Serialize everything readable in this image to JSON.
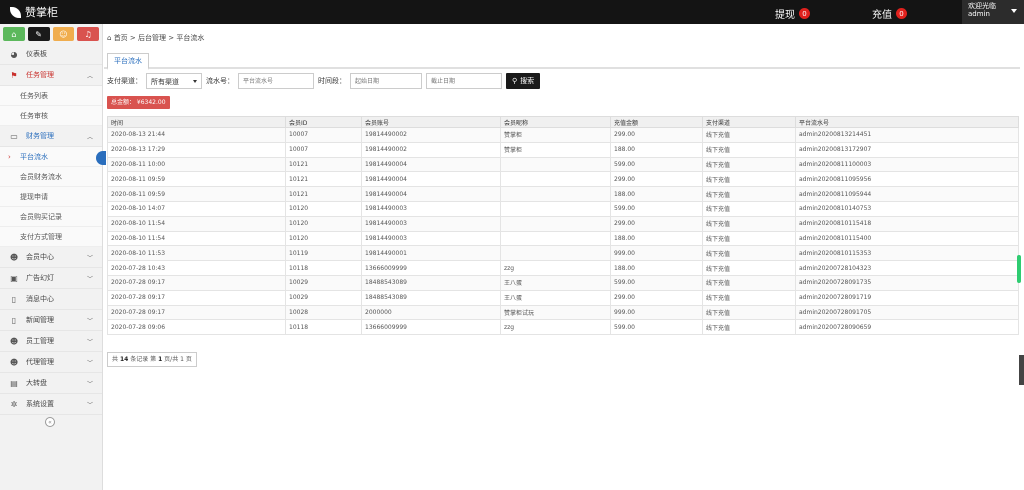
{
  "app": {
    "title": "赞掌柜"
  },
  "topbar": {
    "withdraw_label": "提现",
    "withdraw_count": "0",
    "recharge_label": "充值",
    "recharge_count": "0",
    "welcome": "欢迎光临",
    "username": "admin"
  },
  "colors": {
    "accent": "#c9302c",
    "link": "#2a6ebd",
    "topbar": "#141414",
    "badge": "#e0211d"
  },
  "shortcuts": [
    {
      "icon": "home-icon",
      "color": "#5cb85c"
    },
    {
      "icon": "pencil-icon",
      "color": "#1a1a1a"
    },
    {
      "icon": "users-icon",
      "color": "#f0ad4e"
    },
    {
      "icon": "bell-icon",
      "color": "#d9534f"
    }
  ],
  "sidebar": {
    "dashboard": "仪表板",
    "task_mgmt": "任务管理",
    "task_list": "任务列表",
    "task_review": "任务审核",
    "finance_mgmt": "财务管理",
    "platform_flow": "平台流水",
    "member_finance_flow": "会员财务流水",
    "withdraw_apply": "提现申请",
    "member_purchase": "会员购买记录",
    "payment_mgmt": "支付方式管理",
    "member_center": "会员中心",
    "ads": "广告幻灯",
    "messages": "消息中心",
    "news": "新闻管理",
    "staff": "员工管理",
    "agent": "代理管理",
    "wheel": "大转盘",
    "settings": "系统设置"
  },
  "breadcrumb": {
    "home": "首页",
    "sep1": ">",
    "admin": "后台管理",
    "sep2": ">",
    "current": "平台流水"
  },
  "tab": {
    "label": "平台流水"
  },
  "filters": {
    "channel_label": "支付渠道：",
    "channel_value": "所有渠道",
    "serial_label": "流水号：",
    "serial_placeholder": "平台流水号",
    "time_label": "时间段：",
    "start_placeholder": "起始日期",
    "end_placeholder": "截止日期",
    "search_button": "搜索"
  },
  "total": {
    "label": "总金额： ¥6342.00"
  },
  "table": {
    "headers": [
      "时间",
      "会员ID",
      "会员账号",
      "会员昵称",
      "充值金额",
      "支付渠道",
      "平台流水号"
    ],
    "rows": [
      [
        "2020-08-13 21:44",
        "10007",
        "19814490002",
        "赞掌柜",
        "299.00",
        "线下充值",
        "admin20200813214451"
      ],
      [
        "2020-08-13 17:29",
        "10007",
        "19814490002",
        "赞掌柜",
        "188.00",
        "线下充值",
        "admin20200813172907"
      ],
      [
        "2020-08-11 10:00",
        "10121",
        "19814490004",
        "",
        "599.00",
        "线下充值",
        "admin20200811100003"
      ],
      [
        "2020-08-11 09:59",
        "10121",
        "19814490004",
        "",
        "299.00",
        "线下充值",
        "admin20200811095956"
      ],
      [
        "2020-08-11 09:59",
        "10121",
        "19814490004",
        "",
        "188.00",
        "线下充值",
        "admin20200811095944"
      ],
      [
        "2020-08-10 14:07",
        "10120",
        "19814490003",
        "",
        "599.00",
        "线下充值",
        "admin20200810140753"
      ],
      [
        "2020-08-10 11:54",
        "10120",
        "19814490003",
        "",
        "299.00",
        "线下充值",
        "admin20200810115418"
      ],
      [
        "2020-08-10 11:54",
        "10120",
        "19814490003",
        "",
        "188.00",
        "线下充值",
        "admin20200810115400"
      ],
      [
        "2020-08-10 11:53",
        "10119",
        "19814490001",
        "",
        "999.00",
        "线下充值",
        "admin20200810115353"
      ],
      [
        "2020-07-28 10:43",
        "10118",
        "13666009999",
        "zzg",
        "188.00",
        "线下充值",
        "admin20200728104323"
      ],
      [
        "2020-07-28 09:17",
        "10029",
        "18488543089",
        "王八蛋",
        "599.00",
        "线下充值",
        "admin20200728091735"
      ],
      [
        "2020-07-28 09:17",
        "10029",
        "18488543089",
        "王八蛋",
        "299.00",
        "线下充值",
        "admin20200728091719"
      ],
      [
        "2020-07-28 09:17",
        "10028",
        "2000000",
        "赞掌柜试玩",
        "999.00",
        "线下充值",
        "admin20200728091705"
      ],
      [
        "2020-07-28 09:06",
        "10118",
        "13666009999",
        "zzg",
        "599.00",
        "线下充值",
        "admin20200728090659"
      ]
    ]
  },
  "pager": {
    "prefix": "共",
    "count": "14",
    "mid": "条记录 第",
    "page": "1",
    "suffix": "页/共 1 页"
  }
}
